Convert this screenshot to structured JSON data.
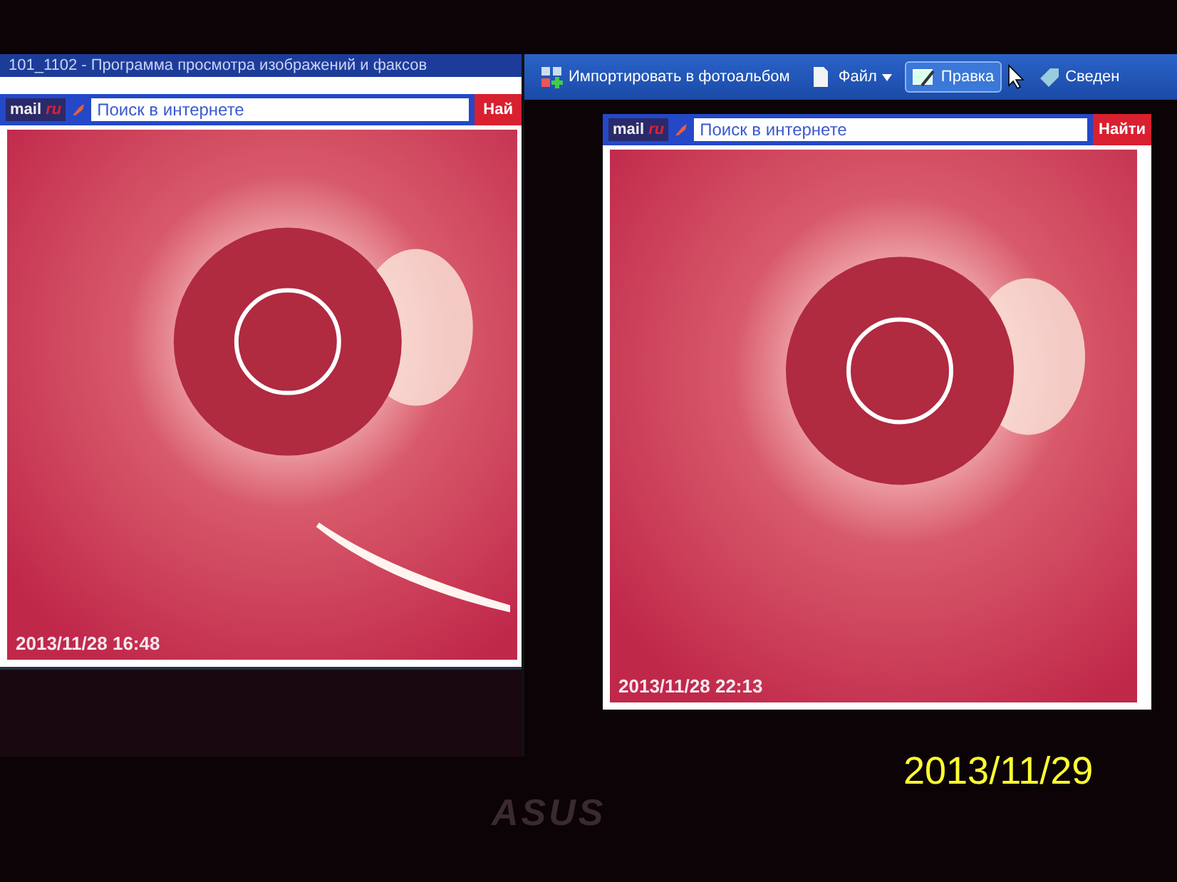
{
  "left_window": {
    "title": "101_1102 - Программа просмотра изображений и факсов",
    "search_toolbar": {
      "logo": "mail",
      "logo_suffix": "ru",
      "placeholder": "Поиск в интернете",
      "button": "Най"
    },
    "image": {
      "timestamp": "2013/11/28 16:48",
      "comet": true
    }
  },
  "right_window": {
    "toolbar": [
      {
        "label": "Импортировать в фотоальбом",
        "kind": "import",
        "selected": false
      },
      {
        "label": "Файл",
        "kind": "menu",
        "selected": false
      },
      {
        "label": "Правка",
        "kind": "edit",
        "selected": true
      },
      {
        "label": "Сведен",
        "kind": "info",
        "selected": false
      }
    ],
    "search_toolbar": {
      "logo": "mail",
      "logo_suffix": "ru",
      "placeholder": "Поиск в интернете",
      "button": "Найти"
    },
    "image": {
      "timestamp": "2013/11/28 22:13",
      "comet": false
    }
  },
  "monitor_logo": "ASUS",
  "photo_date": "2013/11/29"
}
